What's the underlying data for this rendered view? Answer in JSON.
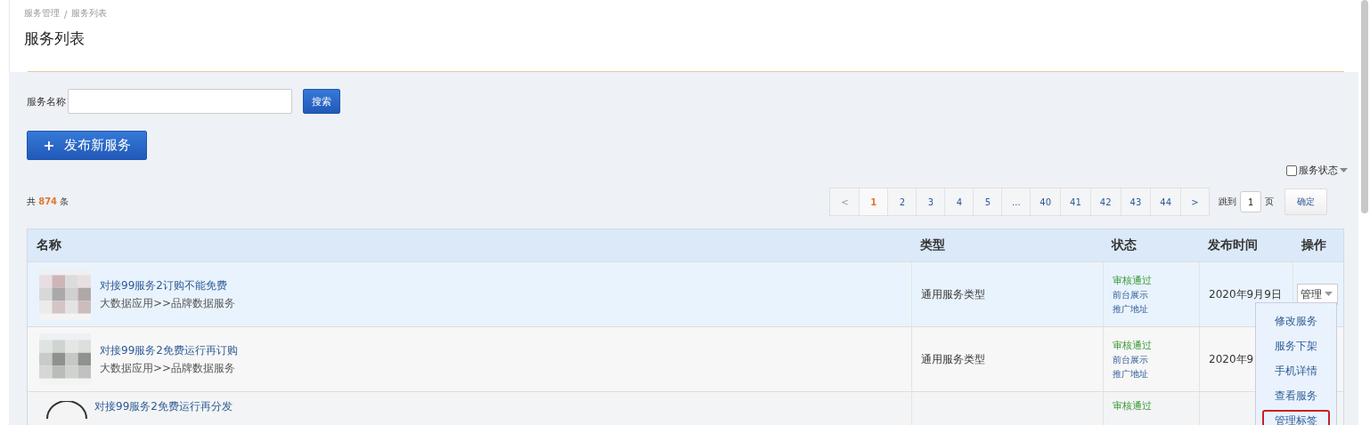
{
  "breadcrumb": {
    "items": [
      "服务管理",
      "服务列表"
    ],
    "separator": "/"
  },
  "title": "服务列表",
  "search": {
    "label": "服务名称",
    "button": "搜索"
  },
  "publish_button": {
    "icon": "+",
    "label": "发布新服务"
  },
  "status_filter": {
    "label": "服务状态",
    "checked": false
  },
  "total": {
    "prefix": "共",
    "count": "874",
    "suffix": "条"
  },
  "pagination": {
    "prev": "<",
    "next": ">",
    "pages": [
      {
        "label": "1",
        "selected": true
      },
      {
        "label": "2",
        "selected": false
      },
      {
        "label": "3",
        "selected": false
      },
      {
        "label": "4",
        "selected": false
      },
      {
        "label": "5",
        "selected": false
      },
      {
        "label": "...",
        "selected": false
      },
      {
        "label": "40",
        "selected": false
      },
      {
        "label": "41",
        "selected": false
      },
      {
        "label": "42",
        "selected": false
      },
      {
        "label": "43",
        "selected": false
      },
      {
        "label": "44",
        "selected": false
      }
    ],
    "jump_label": "跳到",
    "jump_value": "1",
    "page_unit": "页",
    "confirm": "确定"
  },
  "table": {
    "columns": [
      "名称",
      "类型",
      "状态",
      "发布时间",
      "操作"
    ],
    "rows": [
      {
        "title": "对接99服务2订购不能免费",
        "category": "大数据应用>>品牌数据服务",
        "type": "通用服务类型",
        "status": "审核通过",
        "links": [
          "前台展示",
          "推广地址"
        ],
        "date": "2020年9月9日",
        "action": "管理",
        "highlighted": true
      },
      {
        "title": "对接99服务2免费运行再订购",
        "category": "大数据应用>>品牌数据服务",
        "type": "通用服务类型",
        "status": "审核通过",
        "links": [
          "前台展示",
          "推广地址"
        ],
        "date": "2020年9",
        "highlighted": false
      },
      {
        "title": "对接99服务2免费运行再分发",
        "status": "审核通过"
      }
    ]
  },
  "action_menu": {
    "items": [
      {
        "label": "修改服务",
        "selected": false
      },
      {
        "label": "服务下架",
        "selected": false
      },
      {
        "label": "手机详情",
        "selected": false
      },
      {
        "label": "查看服务",
        "selected": false
      },
      {
        "label": "管理标签",
        "selected": true
      }
    ]
  }
}
